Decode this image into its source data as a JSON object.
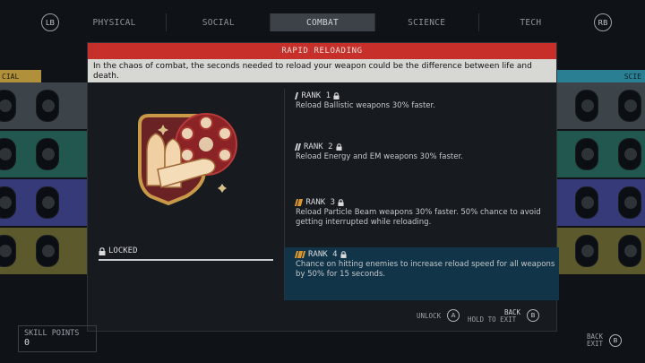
{
  "top_bar": {
    "left_bumper": "LB",
    "right_bumper": "RB",
    "tabs": [
      {
        "label": "PHYSICAL",
        "active": false
      },
      {
        "label": "SOCIAL",
        "active": false
      },
      {
        "label": "COMBAT",
        "active": true
      },
      {
        "label": "SCIENCE",
        "active": false
      },
      {
        "label": "TECH",
        "active": false
      }
    ]
  },
  "background": {
    "left_category": "CIAL",
    "right_category": "SCIE"
  },
  "dialog": {
    "title": "RAPID RELOADING",
    "description": "In the chaos of combat, the seconds needed to reload your weapon could be the difference between life and death.",
    "status": "LOCKED",
    "ranks": [
      {
        "label": "RANK 1",
        "description": "Reload Ballistic weapons 30% faster.",
        "color": "#c9ccd0",
        "selected": false
      },
      {
        "label": "RANK 2",
        "description": "Reload Energy and EM weapons 30% faster.",
        "color": "#c9ccd0",
        "selected": false
      },
      {
        "label": "RANK 3",
        "description": "Reload Particle Beam weapons 30% faster. 50% chance to avoid getting interrupted while reloading.",
        "color": "#e09a2c",
        "selected": false
      },
      {
        "label": "RANK 4",
        "description": "Chance on hitting enemies to increase reload speed for all weapons by 50% for 15 seconds.",
        "color": "#e09a2c",
        "selected": true
      }
    ],
    "footer": {
      "unlock_label": "UNLOCK",
      "unlock_key": "A",
      "hold_to_exit_label": "HOLD TO EXIT",
      "back_label": "BACK",
      "back_key": "B"
    }
  },
  "skill_points": {
    "label": "SKILL POINTS",
    "value": "0"
  },
  "corner_back": {
    "label_top": "BACK",
    "label_bottom": "EXIT",
    "key": "B"
  },
  "colors": {
    "title_bar": "#c7302a",
    "selected_rank": "#123449",
    "accent_orange": "#e09a2c",
    "category_left": "#b0903a",
    "category_right": "#2a7f93"
  }
}
